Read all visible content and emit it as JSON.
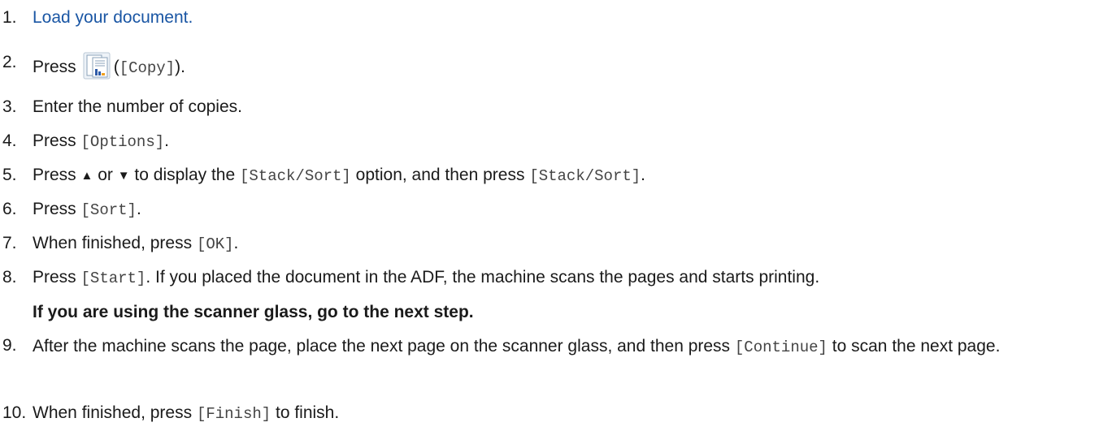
{
  "steps": [
    {
      "num": "1.",
      "parts": {
        "a": "Load your document."
      }
    },
    {
      "num": "2.",
      "parts": {
        "a": "Press",
        "b": "(",
        "c": "[Copy]",
        "d": ")."
      },
      "icon": "copy-icon"
    },
    {
      "num": "3.",
      "parts": {
        "a": "Enter the number of copies."
      }
    },
    {
      "num": "4.",
      "parts": {
        "a": "Press ",
        "b": "[Options]",
        "c": "."
      }
    },
    {
      "num": "5.",
      "parts": {
        "a": "Press ",
        "b": "▲",
        "c": " or ",
        "d": "▼",
        "e": " to display the ",
        "f": "[Stack/Sort]",
        "g": " option, and then press ",
        "h": "[Stack/Sort]",
        "i": "."
      }
    },
    {
      "num": "6.",
      "parts": {
        "a": "Press ",
        "b": "[Sort]",
        "c": "."
      }
    },
    {
      "num": "7.",
      "parts": {
        "a": "When finished, press ",
        "b": "[OK]",
        "c": "."
      }
    },
    {
      "num": "8.",
      "parts": {
        "a": "Press ",
        "b": "[Start]",
        "c": ". If you placed the document in the ADF, the machine scans the pages and starts printing."
      }
    },
    {
      "num": "",
      "parts": {
        "a": "If you are using the scanner glass, go to the next step."
      }
    },
    {
      "num": "9.",
      "parts": {
        "a": "After the machine scans the page, place the next page on the scanner glass, and then press ",
        "b": "[Continue]",
        "c": " to scan the next page."
      }
    },
    {
      "num": "10.",
      "parts": {
        "a": "When finished, press ",
        "b": "[Finish]",
        "c": " to finish."
      }
    }
  ],
  "colors": {
    "link": "#1a56a4",
    "text": "#1a1a1a",
    "mono": "#444444"
  }
}
